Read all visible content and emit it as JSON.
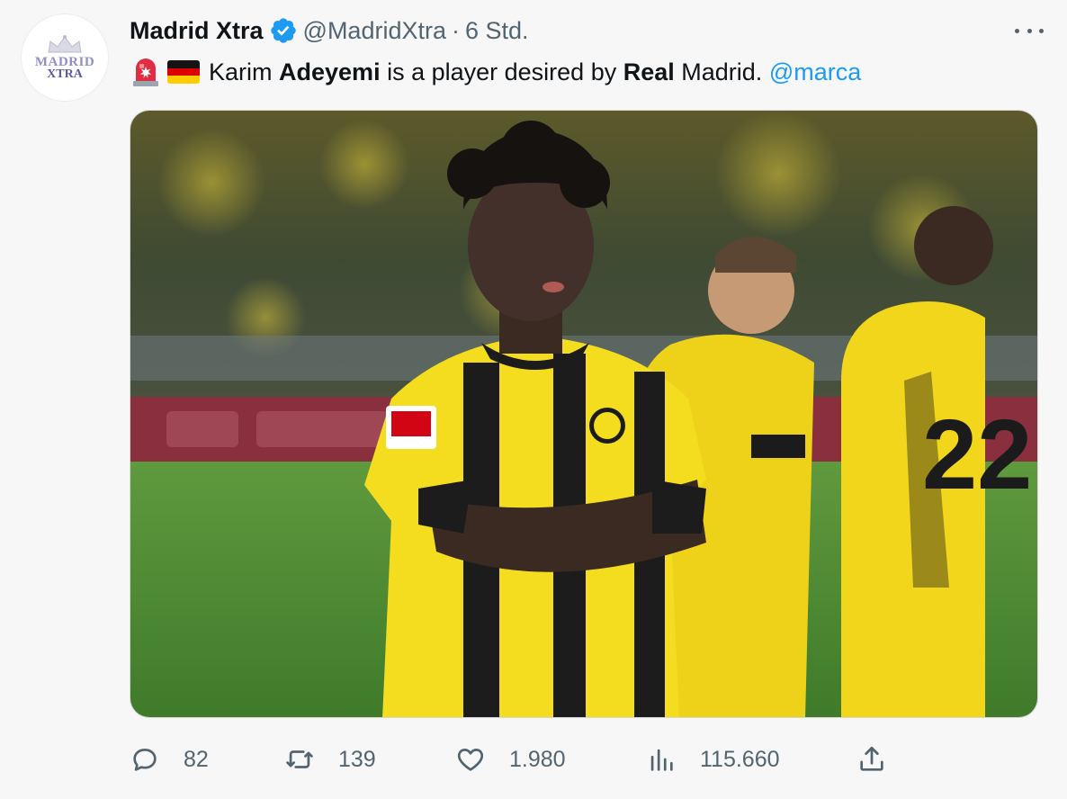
{
  "tweet": {
    "avatar": {
      "line1": "MADRID",
      "line2": "XTRA"
    },
    "display_name": "Madrid Xtra",
    "handle": "@MadridXtra",
    "separator": "·",
    "time": "6 Std.",
    "text_parts": {
      "p1": "Karim ",
      "b1": "Adeyemi",
      "p2": " is a player desired by ",
      "b2": "Real",
      "p3": " Madrid. ",
      "mention": "@marca"
    },
    "emojis": [
      "rotating-light",
      "germany-flag"
    ]
  },
  "actions": {
    "replies": "82",
    "retweets": "139",
    "likes": "1.980",
    "views": "115.660"
  },
  "colors": {
    "link": "#1d9bf0",
    "muted": "#536471",
    "verified": "#1d9bf0",
    "jersey_yellow": "#f4dd1f"
  }
}
